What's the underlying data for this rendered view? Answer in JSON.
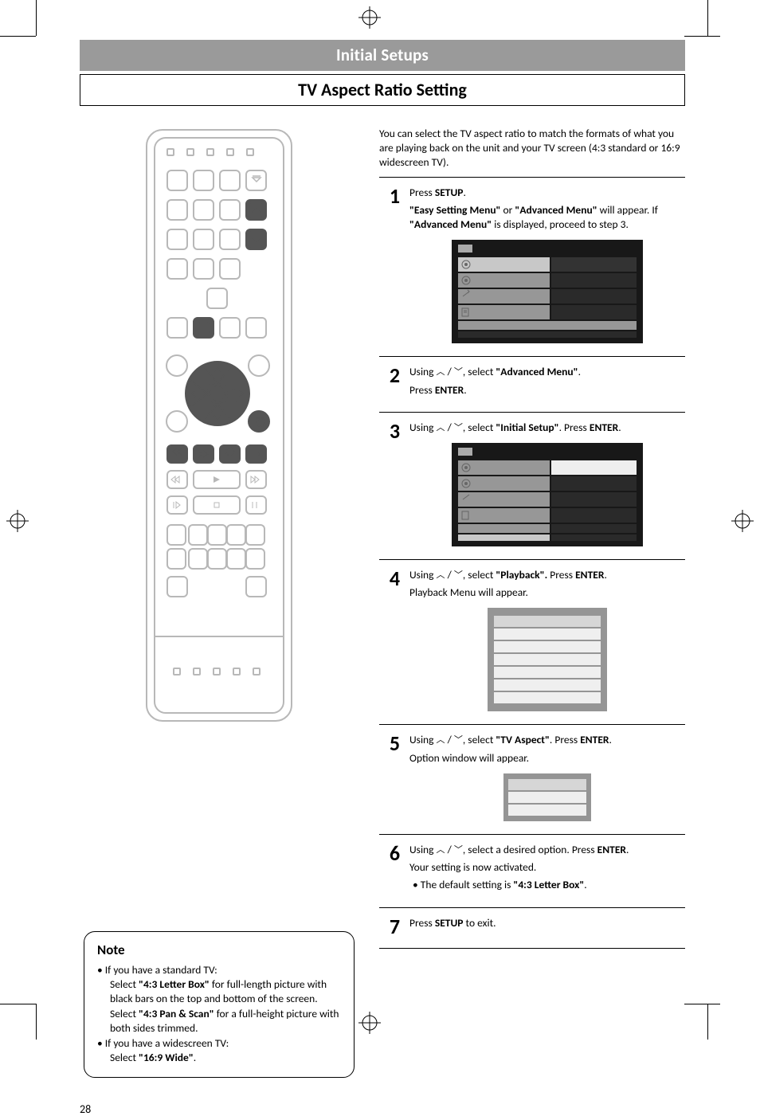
{
  "header": {
    "section": "Initial Setups",
    "title": "TV Aspect Ratio Setting"
  },
  "intro": "You can select the TV aspect ratio to match the formats of what you are playing back on the unit and your TV screen (4:3 standard or 16:9 widescreen TV).",
  "steps": {
    "s1": {
      "num": "1",
      "a": "Press ",
      "b": "SETUP",
      "c": ".",
      "d": "\"Easy Setting Menu\"",
      "e": " or ",
      "f": "\"Advanced Menu\"",
      "g": " will appear. If ",
      "h": "\"Advanced Menu\"",
      "i": " is displayed, proceed to step 3."
    },
    "s2": {
      "num": "2",
      "a": "Using ",
      "b": " / ",
      "c": ", select ",
      "d": "\"Advanced Menu\"",
      "e": ".",
      "f": "Press ",
      "g": "ENTER",
      "h": "."
    },
    "s3": {
      "num": "3",
      "a": "Using ",
      "b": " / ",
      "c": ", select ",
      "d": "\"Initial Setup\"",
      "e": ".  Press ",
      "f": "ENTER",
      "g": "."
    },
    "s4": {
      "num": "4",
      "a": "Using ",
      "b": " / ",
      "c": ", select ",
      "d": "\"Playback\".",
      "e": "  Press ",
      "f": "ENTER",
      "g": ".",
      "h": "Playback Menu will appear."
    },
    "s5": {
      "num": "5",
      "a": "Using ",
      "b": " / ",
      "c": ", select ",
      "d": "\"TV Aspect\"",
      "e": ".  Press ",
      "f": "ENTER",
      "g": ".",
      "h": "Option window will appear."
    },
    "s6": {
      "num": "6",
      "a": "Using ",
      "b": " / ",
      "c": ", select a desired option.  Press ",
      "d": "ENTER",
      "e": ".",
      "f": "Your setting is now activated.",
      "g": "The default setting is ",
      "h": "\"4:3 Letter Box\"",
      "i": "."
    },
    "s7": {
      "num": "7",
      "a": "Press ",
      "b": "SETUP",
      "c": " to exit."
    }
  },
  "note": {
    "heading": "Note",
    "li1a": "If you have a standard TV:",
    "li1b": "Select ",
    "li1c": "\"4:3 Letter Box\"",
    "li1d": " for full-length picture with black bars on the top and bottom of the screen.",
    "li1e": "Select ",
    "li1f": "\"4:3 Pan & Scan\"",
    "li1g": " for a full-height picture with both sides trimmed.",
    "li2a": "If you have a widescreen TV:",
    "li2b": "Select ",
    "li2c": "\"16:9 Wide\"",
    "li2d": "."
  },
  "pageNumber": "28"
}
